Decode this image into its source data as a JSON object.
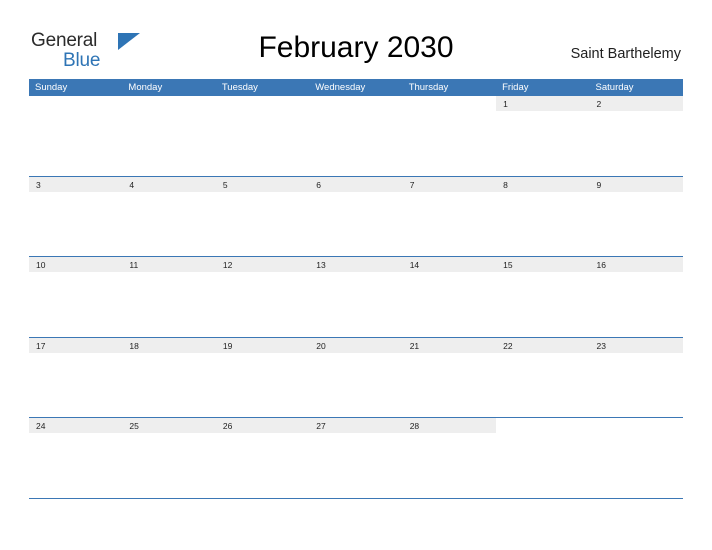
{
  "logo": {
    "line1": "General",
    "line2": "Blue",
    "flag_icon": "flag-triangle-icon"
  },
  "header": {
    "title": "February 2030",
    "subtitle": "Saint Barthelemy"
  },
  "calendar": {
    "accent_color": "#3b77b5",
    "band_color": "#eeeeee",
    "day_headers": [
      "Sunday",
      "Monday",
      "Tuesday",
      "Wednesday",
      "Thursday",
      "Friday",
      "Saturday"
    ],
    "weeks": [
      [
        "",
        "",
        "",
        "",
        "",
        "1",
        "2"
      ],
      [
        "3",
        "4",
        "5",
        "6",
        "7",
        "8",
        "9"
      ],
      [
        "10",
        "11",
        "12",
        "13",
        "14",
        "15",
        "16"
      ],
      [
        "17",
        "18",
        "19",
        "20",
        "21",
        "22",
        "23"
      ],
      [
        "24",
        "25",
        "26",
        "27",
        "28",
        "",
        ""
      ]
    ]
  }
}
